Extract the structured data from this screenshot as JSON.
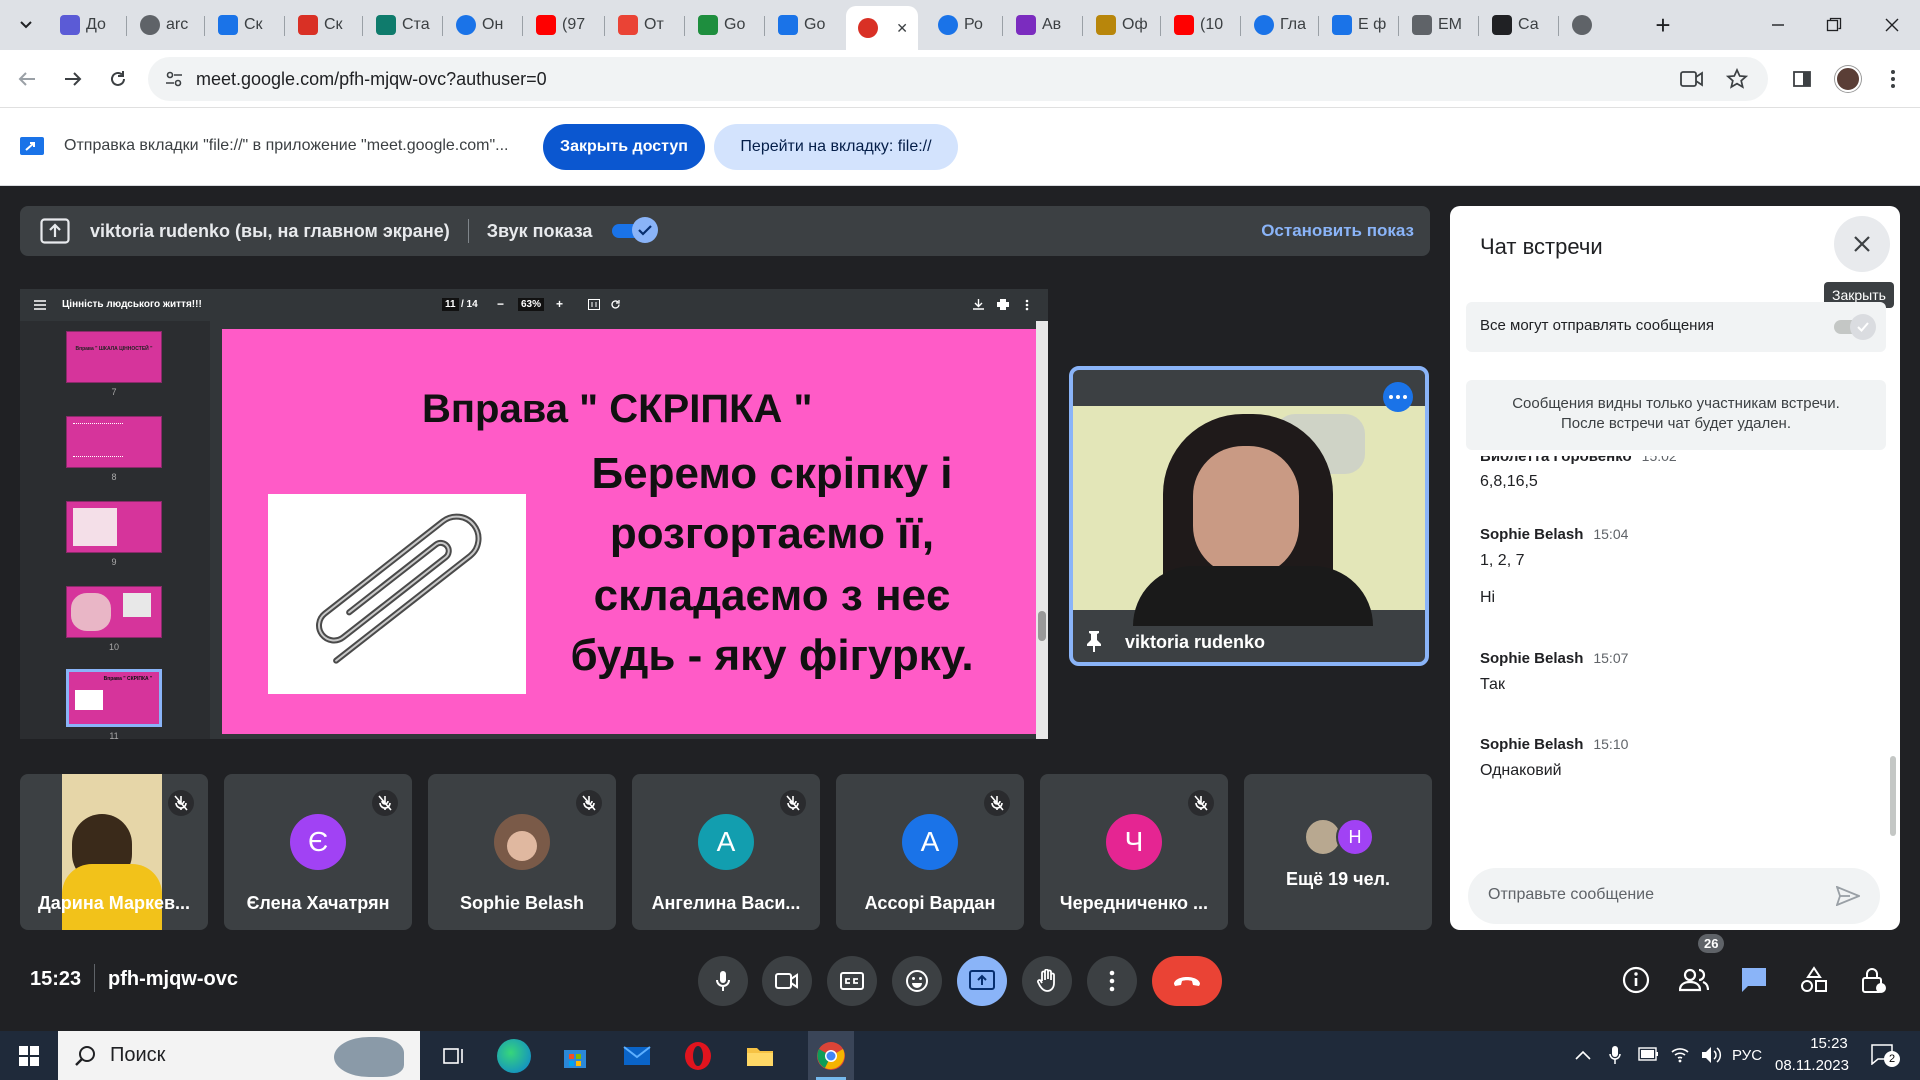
{
  "tabs": [
    {
      "label": "До",
      "icon": "shield-icon",
      "color": "#5b5bd6"
    },
    {
      "label": "arc",
      "icon": "globe-icon",
      "color": "#5f6368"
    },
    {
      "label": "Ск",
      "icon": "heart-hand-icon",
      "color": "#1a73e8"
    },
    {
      "label": "Ск",
      "icon": "heart-icon",
      "color": "#d93025"
    },
    {
      "label": "Ста",
      "icon": "sway-icon",
      "color": "#0f7b6c"
    },
    {
      "label": "Он",
      "icon": "target-icon",
      "color": "#1a73e8"
    },
    {
      "label": "(97",
      "icon": "youtube-icon",
      "color": "#ff0000"
    },
    {
      "label": "От",
      "icon": "gmail-icon",
      "color": "#ea4335"
    },
    {
      "label": "Go",
      "icon": "classroom-icon",
      "color": "#1e8e3e"
    },
    {
      "label": "Go",
      "icon": "forms-icon",
      "color": "#1a73e8"
    },
    {
      "label": "",
      "icon": "record-icon",
      "color": "#d93025",
      "active": true
    },
    {
      "label": "Ро",
      "icon": "circle-icon",
      "color": "#1a73e8"
    },
    {
      "label": "Ав",
      "icon": "viber-icon",
      "color": "#7b2cbf"
    },
    {
      "label": "Оф",
      "icon": "crest-icon",
      "color": "#b8860b"
    },
    {
      "label": "(10",
      "icon": "youtube-icon",
      "color": "#ff0000"
    },
    {
      "label": "Гла",
      "icon": "c-icon",
      "color": "#1a73e8"
    },
    {
      "label": "Е ф",
      "icon": "puzzle-icon",
      "color": "#1a73e8"
    },
    {
      "label": "ЕМ",
      "icon": "doc-icon",
      "color": "#5f6368"
    },
    {
      "label": "Са",
      "icon": "wikipedia-icon",
      "color": "#202124"
    },
    {
      "label": "",
      "icon": "globe-icon",
      "color": "#5f6368"
    }
  ],
  "browser": {
    "url": "meet.google.com/pfh-mjqw-ovc?authuser=0"
  },
  "infobar": {
    "text": "Отправка вкладки \"file://\" в приложение \"meet.google.com\"...",
    "stop_label": "Закрыть доступ",
    "goto_label": "Перейти на вкладку: file://"
  },
  "present_bar": {
    "presenter": "viktoria rudenko (вы, на главном экране)",
    "sound_label": "Звук показа",
    "stop_label": "Остановить показ"
  },
  "pdf": {
    "title": "Цінність людського життя!!!",
    "page": "11",
    "pages": "/ 14",
    "zoom": "63%",
    "thumbs": [
      {
        "num": "7",
        "text": "Вправа \" ШКАЛА ЦІННОСТЕЙ \""
      },
      {
        "num": "8",
        "text": ""
      },
      {
        "num": "9",
        "text": ""
      },
      {
        "num": "10",
        "text": ""
      },
      {
        "num": "11",
        "text": "Вправа \" СКРІПКА \"",
        "selected": true
      }
    ],
    "slide": {
      "title": "Вправа \" СКРІПКА \"",
      "lines": [
        "Беремо скріпку і",
        "розгортаємо її,",
        "складаємо з неє",
        "будь - яку фігурку."
      ]
    }
  },
  "selfview": {
    "name": "viktoria rudenko"
  },
  "participants": [
    {
      "name": "Дарина Маркев...",
      "initial": "",
      "color": "#d4a017",
      "photo": true
    },
    {
      "name": "Єлена Хачатрян",
      "initial": "Є",
      "color": "#a142f4"
    },
    {
      "name": "Sophie Belash",
      "initial": "",
      "color": "#6b4a3a",
      "photo": true
    },
    {
      "name": "Ангелина Васи...",
      "initial": "А",
      "color": "#129eaf"
    },
    {
      "name": "Ассорі Вардан",
      "initial": "А",
      "color": "#1a73e8"
    },
    {
      "name": "Чередниченко ...",
      "initial": "Ч",
      "color": "#e52592"
    }
  ],
  "more_tile": {
    "label": "Ещё 19 чел.",
    "avatar_initial": "Н"
  },
  "chat": {
    "title": "Чат встречи",
    "tooltip": "Закрыть",
    "toggle_label": "Все могут отправлять сообщения",
    "notice_line1": "Сообщения видны только участникам встречи.",
    "notice_line2": "После встречи чат будет удален.",
    "messages": [
      {
        "name": "Виолетта Горовенко",
        "time": "15:02",
        "texts": [
          "6,8,16,5"
        ]
      },
      {
        "name": "Sophie Belash",
        "time": "15:04",
        "texts": [
          "1, 2, 7",
          "Ні"
        ]
      },
      {
        "name": "Sophie Belash",
        "time": "15:07",
        "texts": [
          "Так"
        ]
      },
      {
        "name": "Sophie Belash",
        "time": "15:10",
        "texts": [
          "Однаковий"
        ]
      }
    ],
    "input_placeholder": "Отправьте сообщение"
  },
  "meeting": {
    "time": "15:23",
    "code": "pfh-mjqw-ovc",
    "participant_count": "26"
  },
  "taskbar": {
    "search_label": "Поиск",
    "lang": "РУС",
    "time": "15:23",
    "date": "08.11.2023",
    "notif_count": "2"
  },
  "colors": {
    "meet_bg": "#202124",
    "accent_blue": "#1a73e8",
    "end_call_red": "#ea4335",
    "slide_pink": "#ff5bc7"
  }
}
